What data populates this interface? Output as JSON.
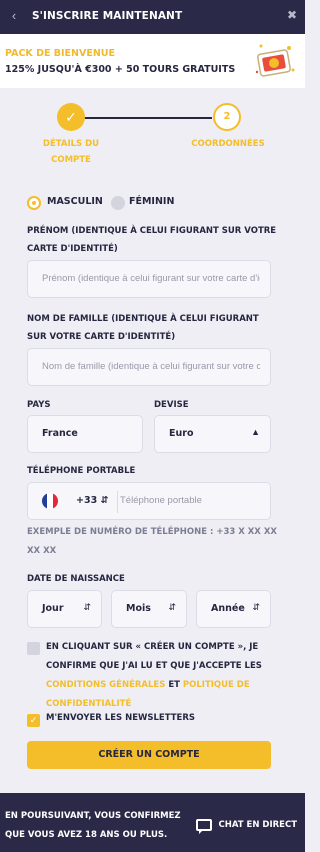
{
  "header": {
    "back_icon": "chevron-left-icon",
    "title": "S'INSCRIRE MAINTENANT",
    "close_icon": "close-icon"
  },
  "banner": {
    "title": "PACK DE BIENVENUE",
    "offer": "125% JUSQU'À €300 + 50 TOURS GRATUITS",
    "image_icon": "gift-icon"
  },
  "stepper": {
    "step1": {
      "label": "DÉTAILS DU COMPTE",
      "icon": "check-icon",
      "status": "completed"
    },
    "step2": {
      "label": "COORDONNÉES",
      "number": "2",
      "status": "pending"
    }
  },
  "form": {
    "gender": {
      "male": "MASCULIN",
      "female": "FÉMININ",
      "selected": "MASCULIN"
    },
    "first_name": {
      "label": "PRÉNOM (IDENTIQUE À CELUI FIGURANT SUR VOTRE CARTE D'IDENTITÉ)",
      "placeholder": "Prénom (identique à celui figurant sur votre carte d'identité)"
    },
    "last_name": {
      "label": "NOM DE FAMILLE (IDENTIQUE À CELUI FIGURANT SUR VOTRE CARTE D'IDENTITÉ)",
      "placeholder": "Nom de famille (identique à celui figurant sur votre carte d'identité)"
    },
    "country": {
      "label": "PAYS",
      "value": "France"
    },
    "currency": {
      "label": "DEVISE",
      "value": "Euro"
    },
    "phone": {
      "label": "TÉLÉPHONE PORTABLE",
      "prefix": "+33",
      "placeholder": "Téléphone portable",
      "hint": "EXEMPLE DE NUMÉRO DE TÉLÉPHONE : +33 X XX XX XX XX"
    },
    "birthdate": {
      "label": "DATE DE NAISSANCE",
      "day": "Jour",
      "month": "Mois",
      "year": "Année"
    },
    "consent": {
      "text_before": "EN CLIQUANT SUR « CRÉER UN COMPTE », JE CONFIRME QUE J'AI LU ET QUE J'ACCEPTE LES",
      "terms_link": "CONDITIONS GÉNÉRALES",
      "and": "ET",
      "privacy_link": "POLITIQUE DE CONFIDENTIALITÉ",
      "checked": false
    },
    "newsletter": {
      "label": "M'ENVOYER LES NEWSLETTERS",
      "checked": true
    },
    "submit": "CRÉER UN COMPTE"
  },
  "footer": {
    "legal": "EN POURSUIVANT, VOUS CONFIRMEZ QUE VOUS AVEZ 18 ANS OU PLUS.",
    "chat": "CHAT EN DIRECT",
    "chat_icon": "chat-bubble-icon"
  },
  "colors": {
    "accent": "#f3be2a",
    "dark": "#2a2a48",
    "background": "#eeeef4"
  }
}
